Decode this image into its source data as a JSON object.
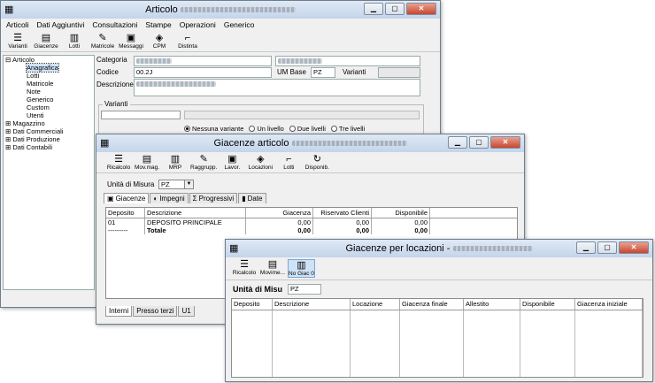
{
  "win1": {
    "title": "Articolo",
    "menu": [
      "Articoli",
      "Dati Aggiuntivi",
      "Consultazioni",
      "Stampe",
      "Operazioni",
      "Generico"
    ],
    "tools": [
      "Varianti",
      "Giacenze",
      "Lotti",
      "Matricole",
      "Messaggi",
      "CPM",
      "Distinta"
    ],
    "tree": [
      {
        "label": "Articolo",
        "indent": 0,
        "exp": "⊟"
      },
      {
        "label": "Anagrafica",
        "indent": 1,
        "sel": true
      },
      {
        "label": "Lotti",
        "indent": 1
      },
      {
        "label": "Matricole",
        "indent": 1
      },
      {
        "label": "Note",
        "indent": 1
      },
      {
        "label": "Generico",
        "indent": 1
      },
      {
        "label": "Custom",
        "indent": 1
      },
      {
        "label": "Utenti",
        "indent": 1
      },
      {
        "label": "Magazzino",
        "indent": 0,
        "exp": "⊞"
      },
      {
        "label": "Dati Commerciali",
        "indent": 0,
        "exp": "⊞"
      },
      {
        "label": "Dati Produzione",
        "indent": 0,
        "exp": "⊞"
      },
      {
        "label": "Dati Contabili",
        "indent": 0,
        "exp": "⊞"
      }
    ],
    "categoria_label": "Categoria",
    "codice_label": "Codice",
    "codice_value": "00.2J",
    "descrizione_label": "Descrizione",
    "um_base_label": "UM Base",
    "um_base_value": "PZ",
    "varianti_label": "Varianti",
    "varianti_group": "Varianti",
    "radios": [
      "Nessuna variante",
      "Un livello",
      "Due livelli",
      "Tre livelli"
    ]
  },
  "win2": {
    "title": "Giacenze articolo",
    "tools": [
      "Ricalcolo",
      "Mov.mag.",
      "MRP",
      "Raggrupp.",
      "Lavor.",
      "Locazioni",
      "Lotti",
      "Disponib."
    ],
    "um_label": "Unità di Misura",
    "um_value": "PZ",
    "tabs": [
      "Giacenze",
      "Impegni",
      "Progressivi",
      "Date"
    ],
    "columns": [
      "Deposito",
      "Descrizione",
      "Giacenza",
      "Riservato Clienti",
      "Disponibile"
    ],
    "rows": [
      {
        "dep": "01",
        "desc": "DEPOSITO PRINCIPALE",
        "giac": "0,00",
        "ris": "0,00",
        "disp": "0,00"
      },
      {
        "dep": "---------",
        "desc": "Totale",
        "giac": "0,00",
        "ris": "0,00",
        "disp": "0,00"
      }
    ],
    "bottom_tabs": [
      "Interni",
      "Presso terzi",
      "U1"
    ]
  },
  "win3": {
    "title": "Giacenze per locazioni -",
    "tools": [
      "Ricalcolo",
      "Movime...",
      "No Giac 0"
    ],
    "um_label": "Unità di Misu",
    "um_value": "PZ",
    "columns": [
      "Deposito",
      "Descrizione",
      "Locazione",
      "Giacenza finale",
      "Allestito",
      "Disponibile",
      "Giacenza iniziale"
    ]
  },
  "colors": {
    "titlebar": "#c4d5ea",
    "selection": "#cfe3f7",
    "close": "#c8462e"
  }
}
